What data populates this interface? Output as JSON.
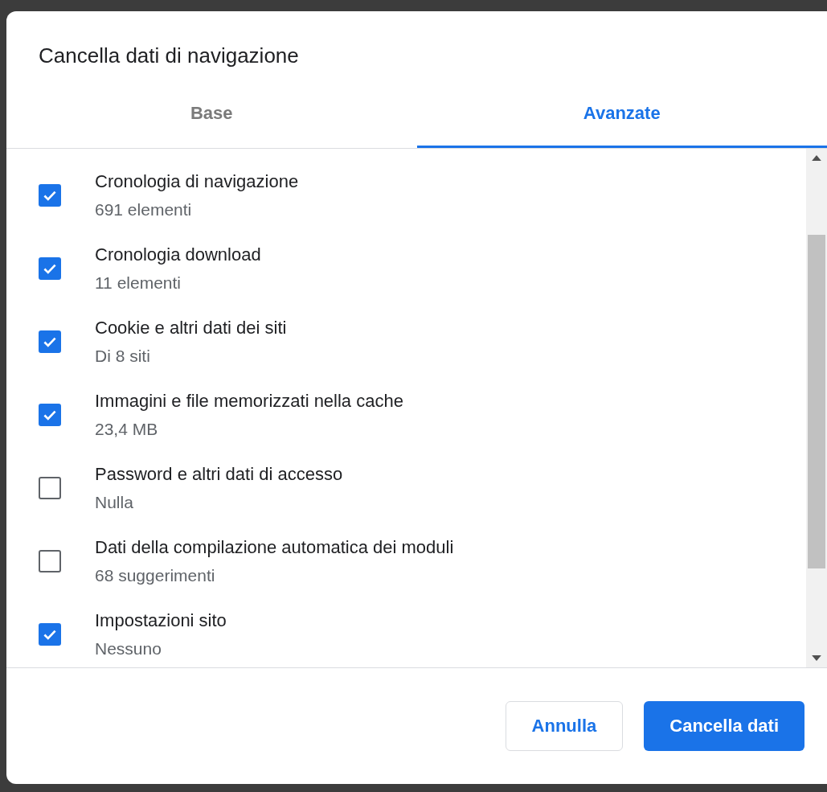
{
  "dialog": {
    "title": "Cancella dati di navigazione"
  },
  "tabs": [
    {
      "label": "Base",
      "selected": false
    },
    {
      "label": "Avanzate",
      "selected": true
    }
  ],
  "items": [
    {
      "label": "Cronologia di navigazione",
      "detail": "691 elementi",
      "checked": true
    },
    {
      "label": "Cronologia download",
      "detail": "11 elementi",
      "checked": true
    },
    {
      "label": "Cookie e altri dati dei siti",
      "detail": "Di 8 siti",
      "checked": true
    },
    {
      "label": "Immagini e file memorizzati nella cache",
      "detail": "23,4 MB",
      "checked": true
    },
    {
      "label": "Password e altri dati di accesso",
      "detail": "Nulla",
      "checked": false
    },
    {
      "label": "Dati della compilazione automatica dei moduli",
      "detail": "68 suggerimenti",
      "checked": false
    },
    {
      "label": "Impostazioni sito",
      "detail": "Nessuno",
      "checked": true
    }
  ],
  "buttons": [
    {
      "label": "Annulla",
      "kind": "secondary"
    },
    {
      "label": "Cancella dati",
      "kind": "primary"
    }
  ]
}
